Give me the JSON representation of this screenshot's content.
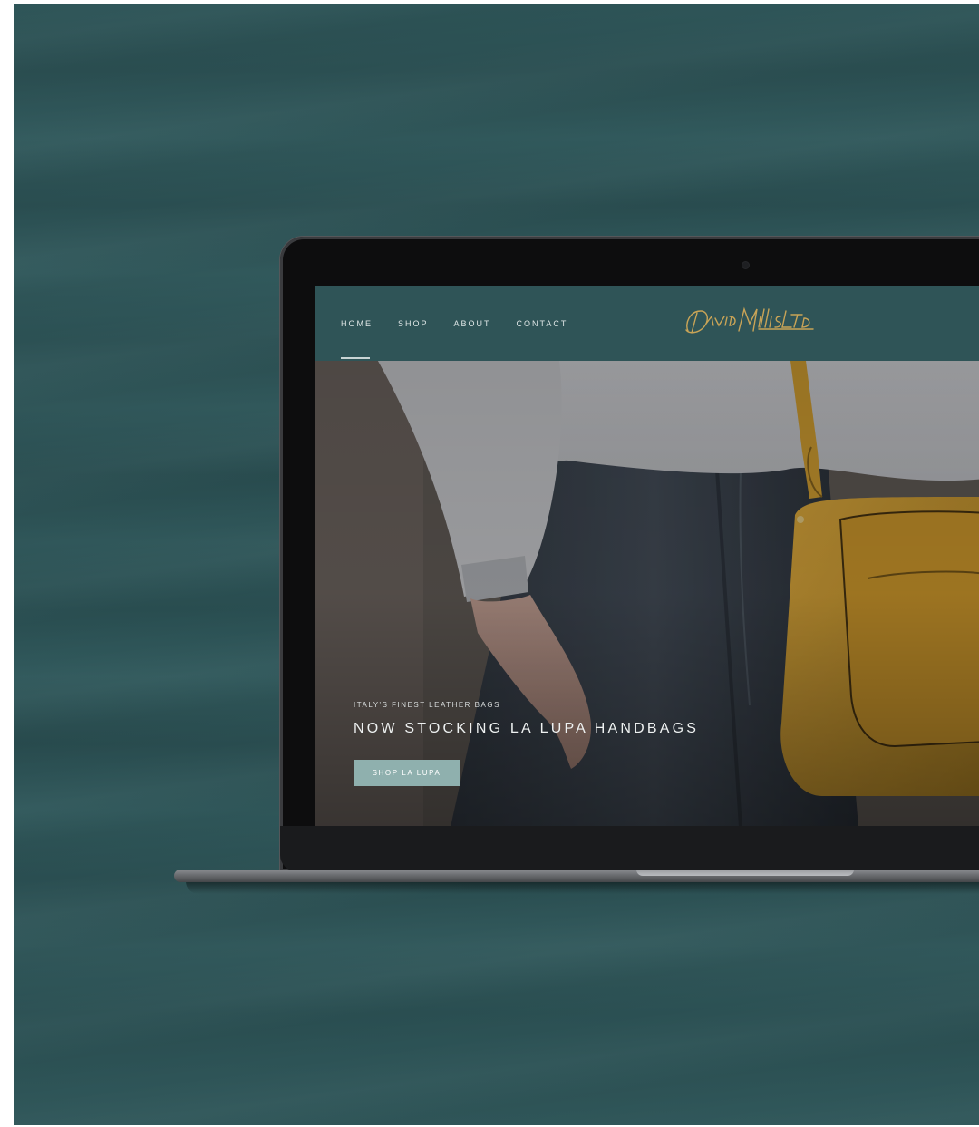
{
  "nav": {
    "items": [
      {
        "label": "HOME",
        "active": true
      },
      {
        "label": "SHOP",
        "active": false
      },
      {
        "label": "ABOUT",
        "active": false
      },
      {
        "label": "CONTACT",
        "active": false
      }
    ]
  },
  "brand": {
    "logo_text": "David Mills Ltd"
  },
  "hero": {
    "eyebrow": "ITALY'S FINEST LEATHER BAGS",
    "title": "NOW STOCKING LA LUPA HANDBAGS",
    "button_label": "SHOP LA LUPA"
  },
  "colors": {
    "background_teal": "#2f5457",
    "logo_gold": "#c9a457",
    "button": "#8fb0ae",
    "bag_mustard": "#c8962a"
  }
}
